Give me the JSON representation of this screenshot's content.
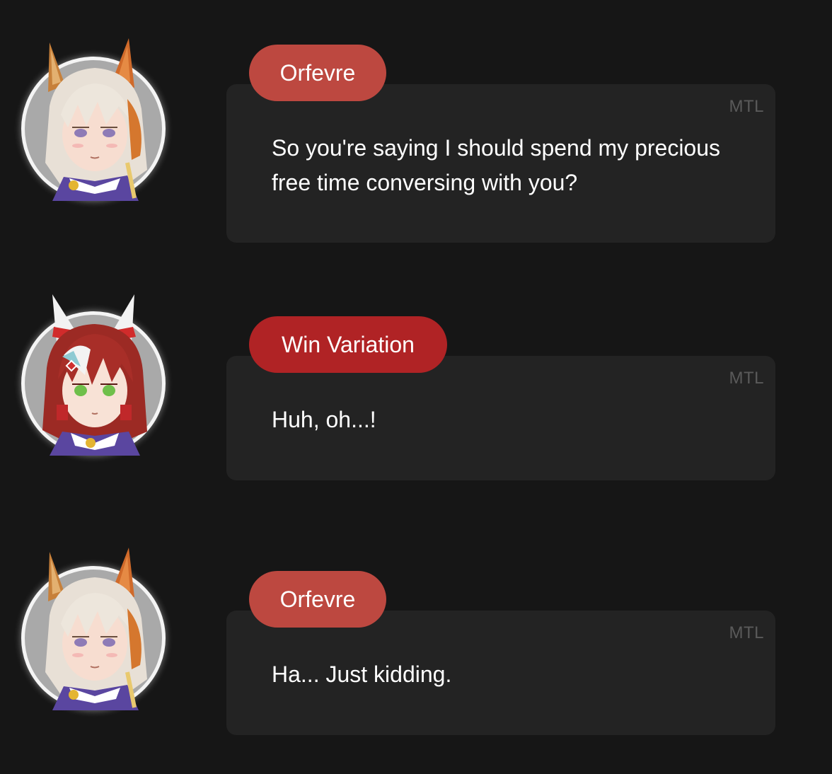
{
  "colors": {
    "background": "#161616",
    "bubble": "#232323",
    "orfevre_tag": "#bd4840",
    "win_variation_tag": "#b02325",
    "mtl_text": "#5a5a5a",
    "message_text": "#ffffff"
  },
  "messages": [
    {
      "speaker": "Orfevre",
      "badge": "MTL",
      "text": "So you're saying I should spend my precious free time conversing with you?",
      "avatar_icon": "orfevre-portrait-icon"
    },
    {
      "speaker": "Win Variation",
      "badge": "MTL",
      "text": "Huh, oh...!",
      "avatar_icon": "win-variation-portrait-icon"
    },
    {
      "speaker": "Orfevre",
      "badge": "MTL",
      "text": "Ha... Just kidding.",
      "avatar_icon": "orfevre-portrait-icon"
    }
  ]
}
